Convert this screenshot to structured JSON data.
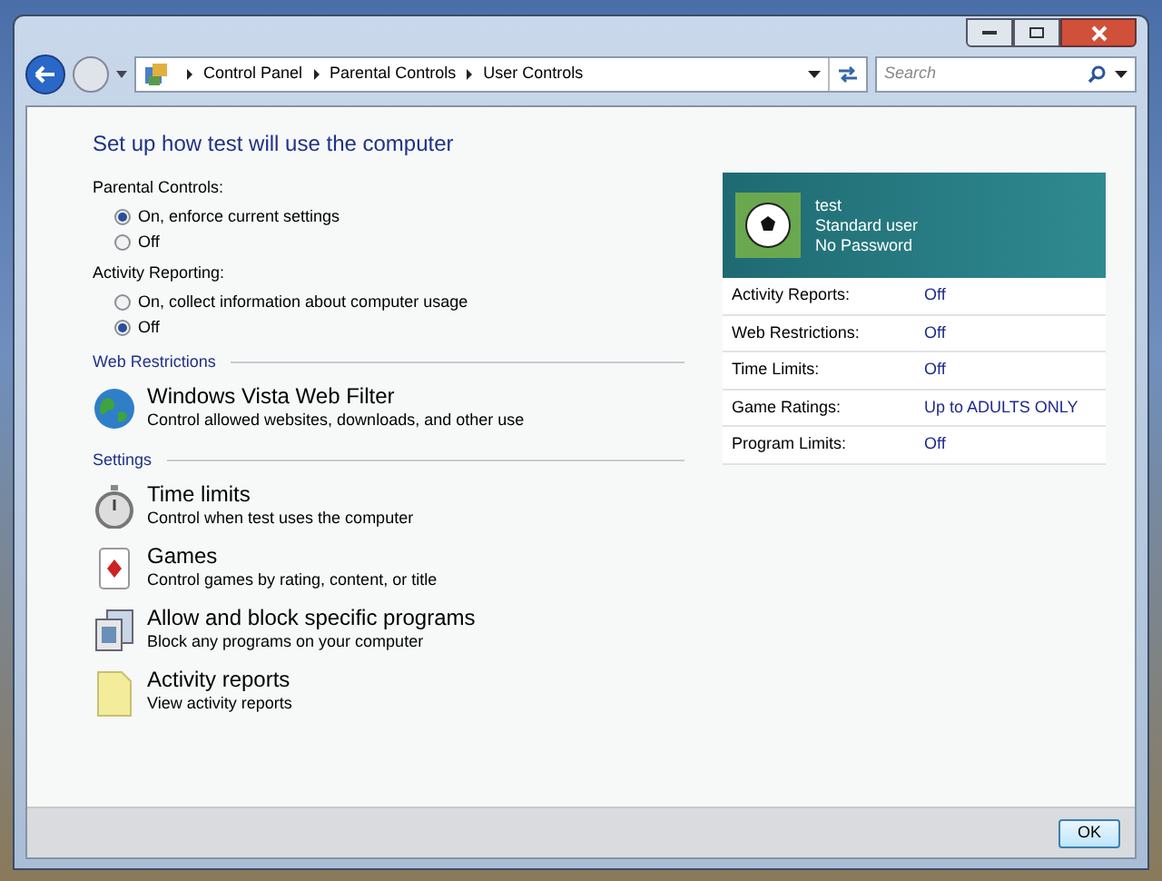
{
  "address_bar": {
    "crumbs": [
      "Control Panel",
      "Parental Controls",
      "User Controls"
    ]
  },
  "search": {
    "placeholder": "Search"
  },
  "heading": "Set up how test will use the computer",
  "option_groups": [
    {
      "label": "Parental Controls:",
      "options": [
        {
          "label": "On, enforce current settings",
          "selected": true
        },
        {
          "label": "Off",
          "selected": false
        }
      ]
    },
    {
      "label": "Activity Reporting:",
      "options": [
        {
          "label": "On, collect information about computer usage",
          "selected": false
        },
        {
          "label": "Off",
          "selected": true
        }
      ]
    }
  ],
  "sections": [
    {
      "title": "Web Restrictions",
      "items": [
        {
          "kind": "globe",
          "title": "Windows Vista Web Filter",
          "description": "Control allowed websites, downloads, and other use"
        }
      ]
    },
    {
      "title": "Settings",
      "items": [
        {
          "kind": "stopwatch",
          "title": "Time limits",
          "description": "Control when test uses the computer"
        },
        {
          "kind": "cards",
          "title": "Games",
          "description": "Control games by rating, content, or title"
        },
        {
          "kind": "programs",
          "title": "Allow and block specific programs",
          "description": "Block any programs on your computer"
        },
        {
          "kind": "document",
          "title": "Activity reports",
          "description": "View activity reports"
        }
      ]
    }
  ],
  "user": {
    "name": "test",
    "account_type": "Standard user",
    "password": "No Password"
  },
  "summary": [
    {
      "label": "Activity Reports:",
      "value": "Off"
    },
    {
      "label": "Web Restrictions:",
      "value": "Off"
    },
    {
      "label": "Time Limits:",
      "value": "Off"
    },
    {
      "label": "Game Ratings:",
      "value": "Up to ADULTS ONLY"
    },
    {
      "label": "Program Limits:",
      "value": "Off"
    }
  ],
  "buttons": [
    "OK"
  ]
}
